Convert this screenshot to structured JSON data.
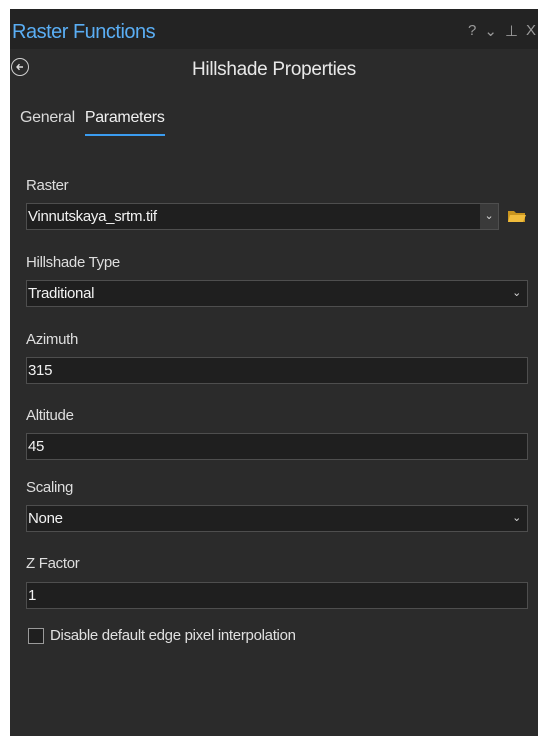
{
  "panel": {
    "title": "Raster Functions",
    "controls": {
      "help": "?",
      "menu": "⌄",
      "pin": "⊥",
      "close": "X"
    },
    "back_icon": "⟵",
    "heading": "Hillshade Properties"
  },
  "tabs": [
    {
      "label": "General",
      "active": false
    },
    {
      "label": "Parameters",
      "active": true
    }
  ],
  "params": {
    "raster": {
      "label": "Raster",
      "value": "Vinnutskaya_srtm.tif"
    },
    "hillshade_type": {
      "label": "Hillshade Type",
      "value": "Traditional"
    },
    "azimuth": {
      "label": "Azimuth",
      "value": "315"
    },
    "altitude": {
      "label": "Altitude",
      "value": "45"
    },
    "scaling": {
      "label": "Scaling",
      "value": "None"
    },
    "z_factor": {
      "label": "Z Factor",
      "value": "1"
    },
    "disable_edge": {
      "label": "Disable default edge pixel interpolation",
      "checked": false
    }
  },
  "caret_glyph": "⌄",
  "colors": {
    "accent": "#3b9cf0",
    "title": "#5aaef4",
    "folder": "#e8b23a",
    "panel_bg": "#2b2b2b"
  }
}
